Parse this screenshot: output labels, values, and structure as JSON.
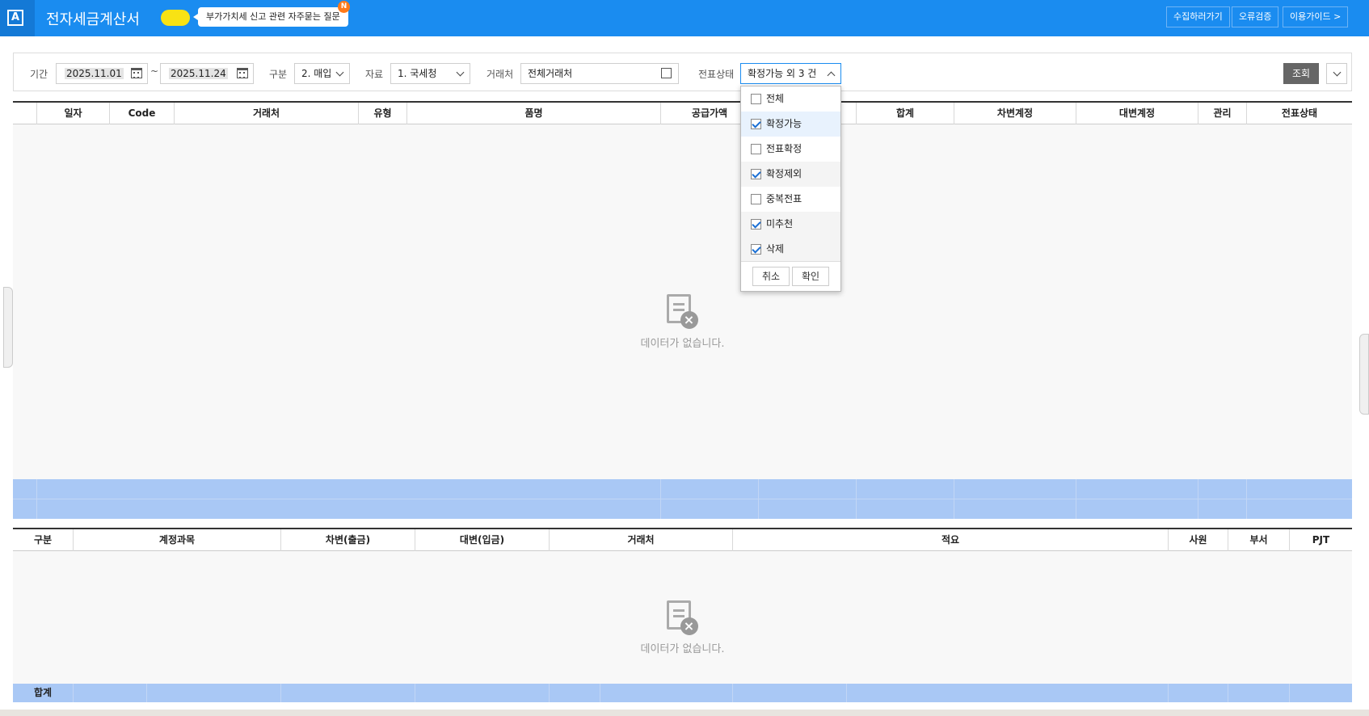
{
  "header": {
    "title": "전자세금계산서",
    "faq_text": "부가가치세 신고 관련 자주묻는 질문",
    "new_badge": "N",
    "buttons": [
      "수집하러가기",
      "오류검증",
      "이용가이드 >"
    ],
    "colors": {
      "bar": "#1a8cf0",
      "toggle": "#f8e214",
      "badge": "#ff7a1a"
    }
  },
  "filters": {
    "period_label": "기간",
    "date_from": "2025.11.01",
    "tilde": "~",
    "date_to": "2025.11.24",
    "type_label": "구분",
    "type_value": "2. 매입",
    "source_label": "자료",
    "source_value": "1. 국세청",
    "partner_label": "거래처",
    "partner_value": "전체거래처",
    "status_label": "전표상태",
    "status_value": "확정가능 외 3 건",
    "search_button": "조회"
  },
  "status_dropdown": {
    "items": [
      {
        "label": "전체",
        "checked": false
      },
      {
        "label": "확정가능",
        "checked": true
      },
      {
        "label": "전표확정",
        "checked": false
      },
      {
        "label": "확정제외",
        "checked": true
      },
      {
        "label": "중복전표",
        "checked": false
      },
      {
        "label": "미추천",
        "checked": true
      },
      {
        "label": "삭제",
        "checked": true
      }
    ],
    "cancel": "취소",
    "confirm": "확인"
  },
  "main_table": {
    "columns": [
      "",
      "일자",
      "Code",
      "거래처",
      "유형",
      "품명",
      "공급가액",
      "",
      "합계",
      "차변계정",
      "대변계정",
      "관리",
      "전표상태"
    ],
    "empty_text": "데이터가 없습니다."
  },
  "journal_table": {
    "columns": [
      "구분",
      "계정과목",
      "차변(출금)",
      "대변(입금)",
      "거래처",
      "적요",
      "사원",
      "부서",
      "PJT"
    ],
    "empty_text": "데이터가 없습니다.",
    "total_label": "합계"
  }
}
